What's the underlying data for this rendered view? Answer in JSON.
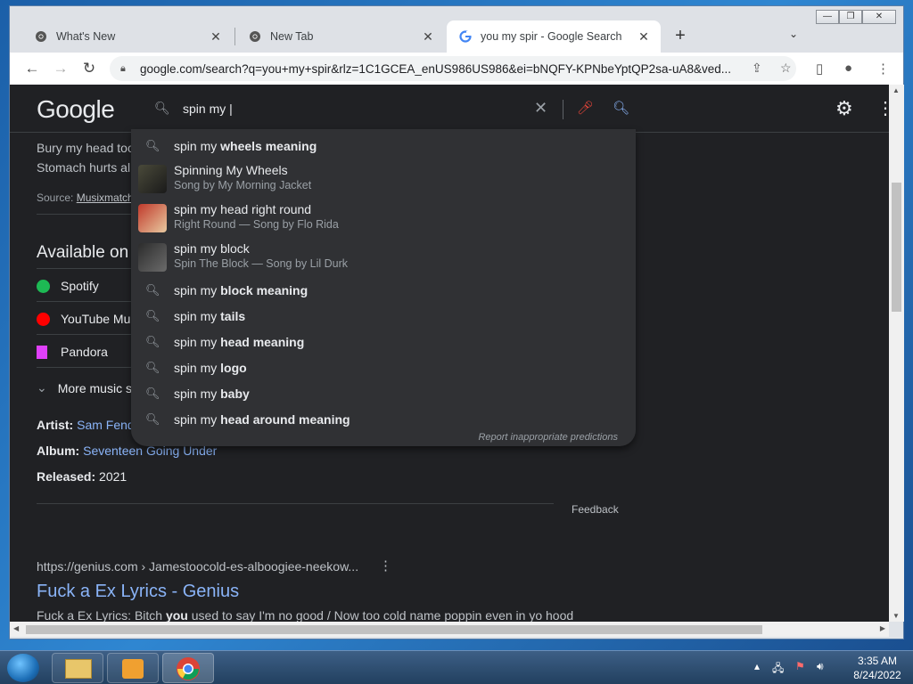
{
  "browser": {
    "tabs": [
      {
        "label": "What's New",
        "active": false
      },
      {
        "label": "New Tab",
        "active": false
      },
      {
        "label": "you my spir - Google Search",
        "active": true
      }
    ],
    "url": "google.com/search?q=you+my+spir&rlz=1C1GCEA_enUS986US986&ei=bNQFY-KPNbeYptQP2sa-uA8&ved...",
    "window_buttons": {
      "minimize": "—",
      "restore": "❐",
      "close": "✕"
    }
  },
  "google": {
    "logo": "Google",
    "search_query": "spin my |",
    "suggestions": [
      {
        "type": "plain",
        "prefix": "spin my ",
        "bold": "wheels meaning"
      },
      {
        "type": "rich",
        "title": "Spinning My Wheels",
        "subtitle": "Song by My Morning Jacket"
      },
      {
        "type": "rich",
        "title": "spin my head right round",
        "subtitle": "Right Round — Song by Flo Rida"
      },
      {
        "type": "rich",
        "title": "spin my block",
        "subtitle": "Spin The Block — Song by Lil Durk"
      },
      {
        "type": "plain",
        "prefix": "spin my ",
        "bold": "block meaning"
      },
      {
        "type": "plain",
        "prefix": "spin my ",
        "bold": "tails"
      },
      {
        "type": "plain",
        "prefix": "spin my ",
        "bold": "head meaning"
      },
      {
        "type": "plain",
        "prefix": "spin my ",
        "bold": "logo"
      },
      {
        "type": "plain",
        "prefix": "spin my ",
        "bold": "baby"
      },
      {
        "type": "plain",
        "prefix": "spin my ",
        "bold": "head around meaning"
      }
    ],
    "report_text": "Report inappropriate predictions"
  },
  "results": {
    "lyrics_line1": "Bury my head too",
    "lyrics_line2": "Stomach hurts al",
    "source_label": "Source:",
    "source_name": "Musixmatch",
    "available_heading": "Available on",
    "services": [
      "Spotify",
      "YouTube Mu",
      "Pandora"
    ],
    "more_music": "More music s",
    "artist_label": "Artist:",
    "artist_value": "Sam Fend",
    "album_label": "Album:",
    "album_value": "Seventeen Going Under",
    "released_label": "Released:",
    "released_value": "2021",
    "feedback": "Feedback",
    "result_breadcrumb": "https://genius.com › Jamestoocold-es-alboogiee-neekow...",
    "result_title": "Fuck a Ex Lyrics - Genius",
    "result_snippet_pre": "Fuck a Ex Lyrics: Bitch ",
    "result_snippet_bold": "you",
    "result_snippet_post": " used to say I'm no good / Now too cold name poppin even in yo hood"
  },
  "taskbar": {
    "time": "3:35 AM",
    "date": "8/24/2022"
  },
  "colors": {
    "page_bg": "#202124",
    "dropdown_bg": "#303134",
    "link": "#8ab4f8",
    "text": "#e8eaed"
  }
}
